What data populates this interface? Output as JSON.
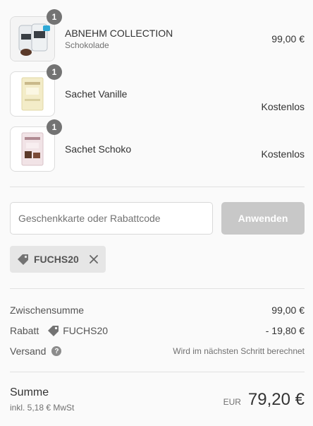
{
  "products": [
    {
      "name": "ABNEHM COLLECTION",
      "variant": "Schokolade",
      "quantity": "1",
      "price": "99,00 €"
    },
    {
      "name": "Sachet Vanille",
      "variant": "",
      "quantity": "1",
      "price": "Kostenlos"
    },
    {
      "name": "Sachet Schoko",
      "variant": "",
      "quantity": "1",
      "price": "Kostenlos"
    }
  ],
  "discount": {
    "placeholder": "Geschenkkarte oder Rabattcode",
    "apply_label": "Anwenden",
    "applied_code": "FUCHS20"
  },
  "totals": {
    "subtotal_label": "Zwischensumme",
    "subtotal_value": "99,00 €",
    "discount_label": "Rabatt",
    "discount_code": "FUCHS20",
    "discount_value": "- 19,80 €",
    "shipping_label": "Versand",
    "shipping_value": "Wird im nächsten Schritt berechnet",
    "total_label": "Summe",
    "tax_note": "inkl. 5,18 € MwSt",
    "currency": "EUR",
    "total_value": "79,20 €"
  },
  "colors": {
    "badge": "#737373",
    "apply_button_disabled": "#c8c8c8",
    "tag_background": "#e6e6e6"
  },
  "icons": [
    "tag-icon",
    "close-icon",
    "question-icon"
  ]
}
